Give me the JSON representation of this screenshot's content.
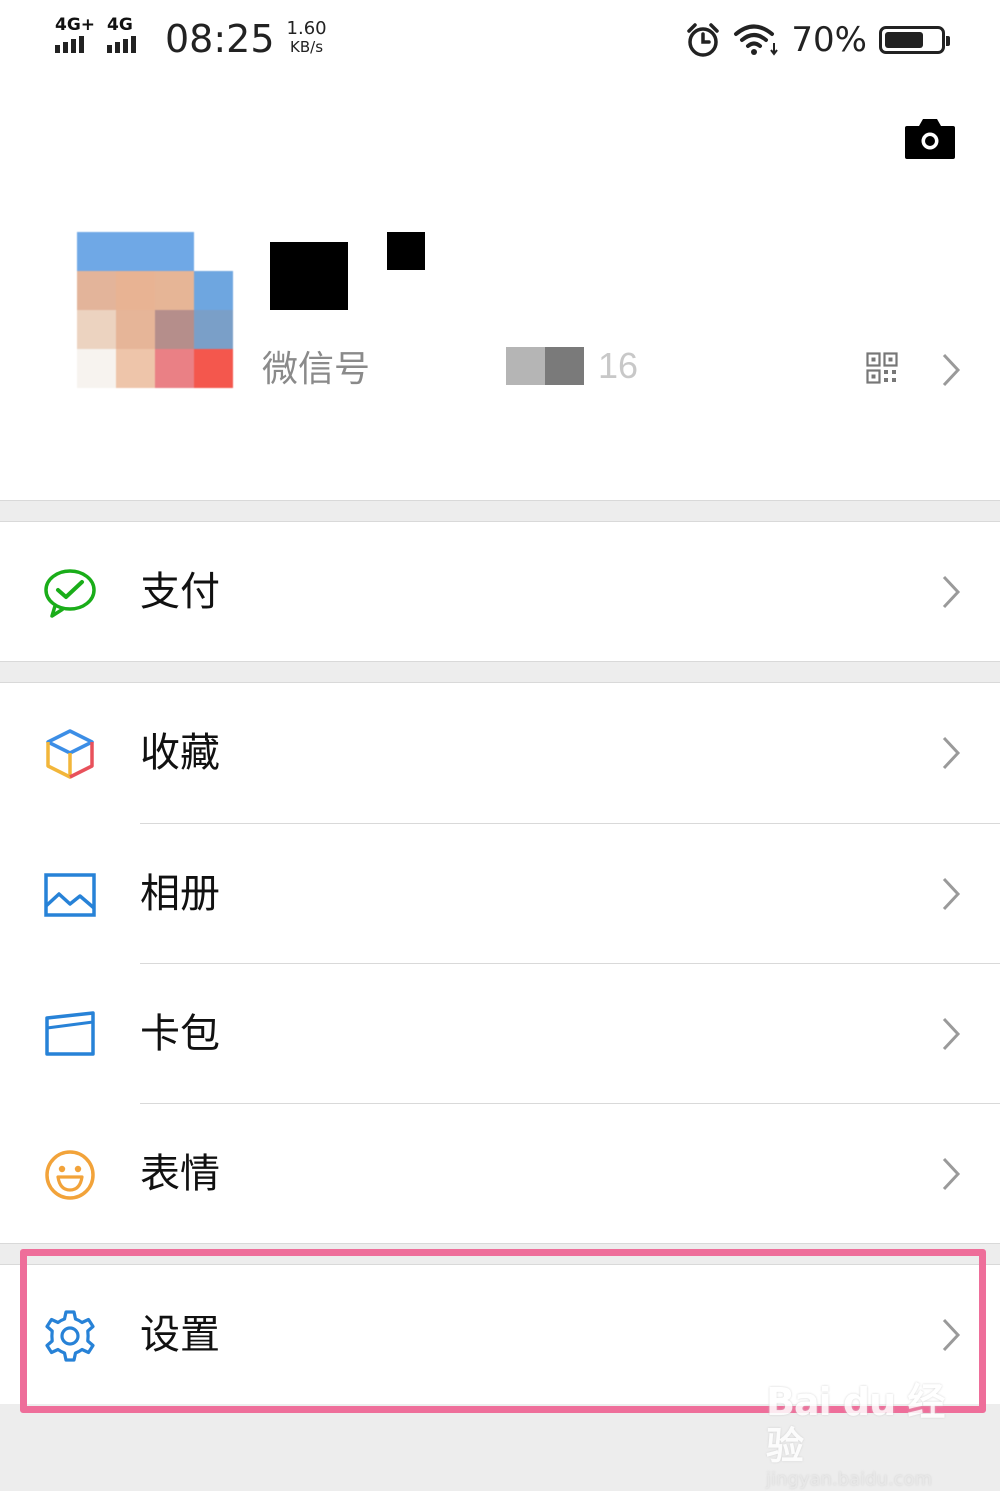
{
  "status_bar": {
    "sim1_network": "4G+",
    "sim2_network": "4G",
    "time": "08:25",
    "speed_value": "1.60",
    "speed_unit": "KB/s",
    "battery_percent": "70%",
    "battery_level": 0.7,
    "icons": [
      "alarm-icon",
      "wifi-icon",
      "battery-icon"
    ]
  },
  "profile": {
    "wechat_id_label": "微信号",
    "wechat_id_visible_suffix": "16",
    "icons": [
      "camera-icon",
      "qr-code-icon",
      "chevron-right-icon"
    ]
  },
  "menu": {
    "pay": {
      "label": "支付",
      "icon": "pay-icon",
      "color": "#1aad19"
    },
    "favorites": {
      "label": "收藏",
      "icon": "favorites-cube-icon"
    },
    "album": {
      "label": "相册",
      "icon": "album-icon",
      "color": "#2782d7"
    },
    "cards": {
      "label": "卡包",
      "icon": "card-wallet-icon",
      "color": "#2782d7"
    },
    "stickers": {
      "label": "表情",
      "icon": "sticker-smile-icon",
      "color": "#f2a33a"
    },
    "settings": {
      "label": "设置",
      "icon": "gear-icon",
      "color": "#2782d7"
    }
  },
  "annotation": {
    "highlight_color": "#ee6e9a"
  },
  "watermark": {
    "brand": "Bai du 经验",
    "url": "jingyan.baidu.com"
  }
}
